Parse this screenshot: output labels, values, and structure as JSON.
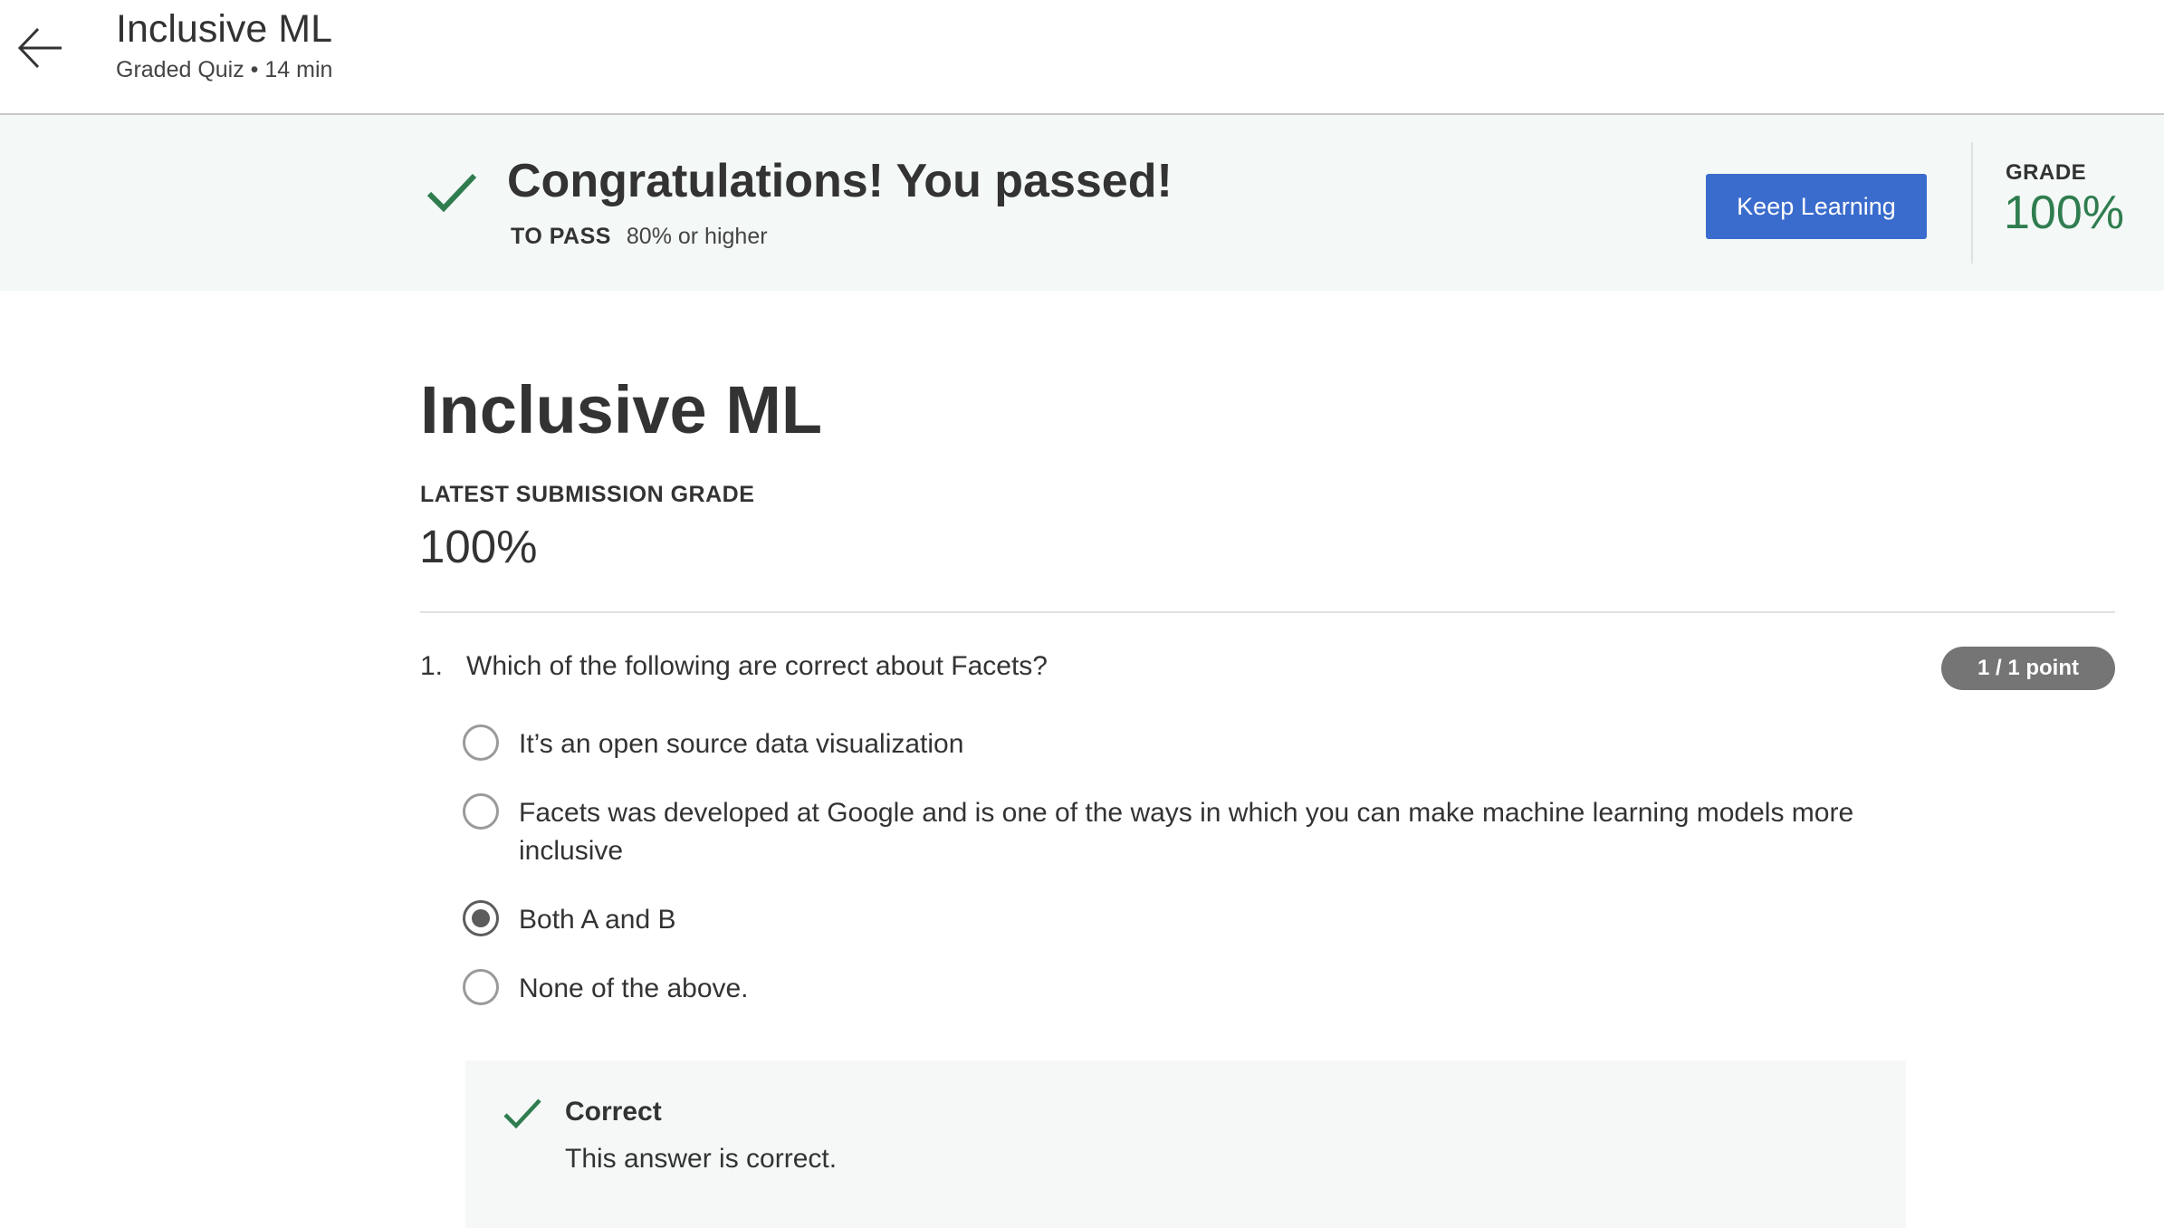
{
  "header": {
    "course_title": "Inclusive ML",
    "meta": "Graded Quiz • 14 min",
    "back_icon": "arrow-left-icon"
  },
  "banner": {
    "heading": "Congratulations! You passed!",
    "to_pass_label": "TO PASS",
    "to_pass_value": "80% or higher",
    "keep_learning_label": "Keep Learning",
    "grade_label": "GRADE",
    "grade_value": "100%",
    "accent_color": "#2f7d4f",
    "button_color": "#3a6ccd"
  },
  "main": {
    "title": "Inclusive ML",
    "latest_label": "LATEST SUBMISSION GRADE",
    "latest_value": "100%"
  },
  "question": {
    "number": "1.",
    "text": "Which of the following are correct about Facets?",
    "points": "1 / 1 point",
    "options": [
      {
        "label": "It’s an open source data visualization",
        "selected": false
      },
      {
        "label": "Facets was developed at Google and is one of the ways in which you can make machine learning models more inclusive",
        "selected": false
      },
      {
        "label": "Both A and B",
        "selected": true
      },
      {
        "label": "None of the above.",
        "selected": false
      }
    ],
    "feedback": {
      "title": "Correct",
      "text": "This answer is correct.",
      "icon": "checkmark-icon"
    }
  }
}
